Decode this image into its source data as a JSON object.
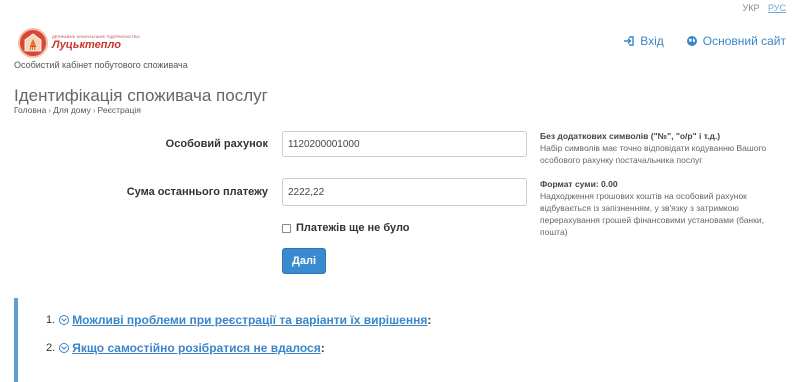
{
  "lang": {
    "ukr": "УКР",
    "rus": "РУС"
  },
  "logo": {
    "small_text": "ДЕРЖАВНЕ КОМУНАЛЬНЕ ПІДПРИЄМСТВО",
    "name": "Луцьктепло",
    "mark_text": "ЛТ"
  },
  "header": {
    "login": "Вхід",
    "main_site": "Основний сайт"
  },
  "subtitle": "Особистий кабінет побутового споживача",
  "page_title": "Ідентифікація споживача послуг",
  "breadcrumb": {
    "home": "Головна",
    "for_home": "Для дому",
    "current": "Реєстрація",
    "sep": "›"
  },
  "form": {
    "account_label": "Особовий рахунок",
    "account_value": "1120200001000",
    "payment_label": "Сума останнього платежу",
    "payment_value": "2222,22",
    "no_payments_label": "Платежів ще не було",
    "submit_label": "Далі"
  },
  "hints": {
    "account_title": "Без додаткових символів (\"№\", \"о/р\" і т.д.)",
    "account_text": "Набір символів має точно відповідати кодуванню Вашого особового рахунку постачальника послуг",
    "payment_title": "Формат суми: 0.00",
    "payment_text": "Надходження грошових коштів на особовий рахунок відбувається із запізненням, у зв'язку з затримкою перерахування грошей фінансовими установами (банки, пошта)"
  },
  "faq": [
    {
      "num": "1.",
      "text": "Можливі проблеми при реєстрації та варіанти їх вирішення"
    },
    {
      "num": "2.",
      "text": "Якщо самостійно розібратися не вдалося"
    }
  ],
  "colors": {
    "accent": "#3a86c8",
    "button": "#3a8ad0",
    "logo_red": "#d8473a",
    "faq_border": "#5aa0d8"
  }
}
